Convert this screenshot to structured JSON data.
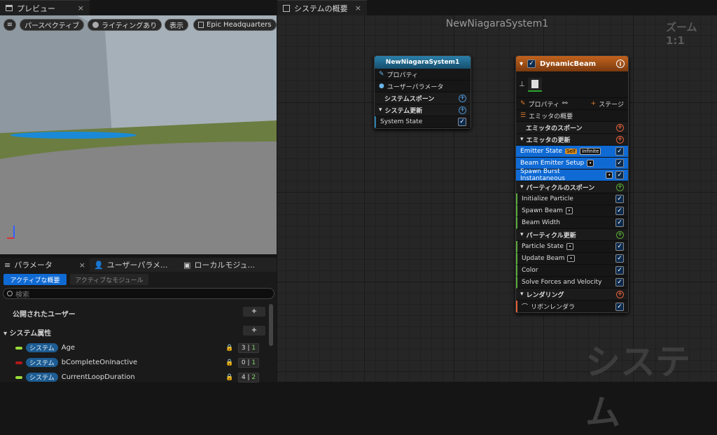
{
  "tabs": {
    "preview": "プレビュー",
    "overview": "システムの概要",
    "close": "×"
  },
  "viewport_toolbar": {
    "perspective": "パースペクティブ",
    "lighting": "ライティングあり",
    "show": "表示",
    "level": "Epic Headquarters"
  },
  "graph": {
    "title": "NewNiagaraSystem1",
    "zoom": "ズーム 1:1",
    "watermark": "システム"
  },
  "system_node": {
    "title": "NewNiagaraSystem1",
    "properties": "プロパティ",
    "user_params": "ユーザーパラメータ",
    "spawn": "システムスポーン",
    "update": "システム更新",
    "module": "System State",
    "check": "✓",
    "plus": "+"
  },
  "emitter_node": {
    "title": "DynamicBeam",
    "info": "i",
    "properties": "プロパティ",
    "stage": "ステージ",
    "summary": "エミッタの概要",
    "spawn": "エミッタのスポーン",
    "update": "エミッタの更新",
    "update_modules": [
      {
        "label": "Emitter State",
        "tag1": "Self",
        "tag2": "Infinite"
      },
      {
        "label": "Beam Emitter Setup"
      },
      {
        "label": "Spawn Burst Instantaneous"
      }
    ],
    "particle_spawn": "パーティクルのスポーン",
    "spawn_modules": [
      "Initialize Particle",
      "Spawn Beam",
      "Beam Width"
    ],
    "particle_update": "パーティクル更新",
    "particle_modules": [
      "Particle State",
      "Update Beam",
      "Color",
      "Solve Forces and Velocity"
    ],
    "rendering": "レンダリング",
    "renderer": "リボンレンダラ"
  },
  "params_panel": {
    "tab1": "パラメータ",
    "tab2": "ユーザーパラメ...",
    "tab3": "ローカルモジュ...",
    "active_overview": "アクティブな概要",
    "active_modules": "アクティブなモジュール",
    "search_placeholder": "検索",
    "published_user": "公開されたユーザー",
    "system_attrs": "システム属性",
    "rows": [
      {
        "badge": "システム",
        "name": "Age",
        "v1": "3",
        "v2": "1",
        "color": "#9bdc3a"
      },
      {
        "badge": "システム",
        "name": "bCompleteOnInactive",
        "v1": "0",
        "v2": "1",
        "color": "#b01818"
      },
      {
        "badge": "システム",
        "name": "CurrentLoopDuration",
        "v1": "4",
        "v2": "2",
        "color": "#9bdc3a"
      }
    ]
  }
}
